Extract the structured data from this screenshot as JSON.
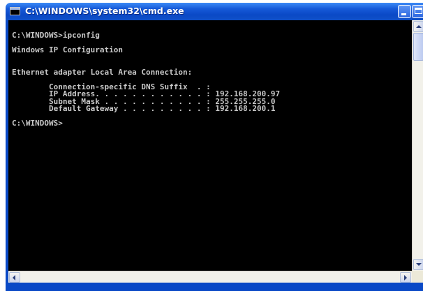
{
  "window": {
    "title": "C:\\WINDOWS\\system32\\cmd.exe",
    "icon": "console-icon",
    "controls": {
      "minimize": "minimize-icon",
      "maximize": "maximize-icon",
      "close": "close-icon"
    },
    "colors": {
      "titlebar": "#0a49c6",
      "console_background": "#000000",
      "console_text": "#c8c8c8"
    }
  },
  "console": {
    "lines": [
      "C:\\WINDOWS>ipconfig",
      "",
      "Windows IP Configuration",
      "",
      "",
      "Ethernet adapter Local Area Connection:",
      "",
      "        Connection-specific DNS Suffix  . :",
      "        IP Address. . . . . . . . . . . . : 192.168.200.97",
      "        Subnet Mask . . . . . . . . . . . : 255.255.255.0",
      "        Default Gateway . . . . . . . . . : 192.168.200.1",
      "",
      "C:\\WINDOWS>"
    ]
  }
}
